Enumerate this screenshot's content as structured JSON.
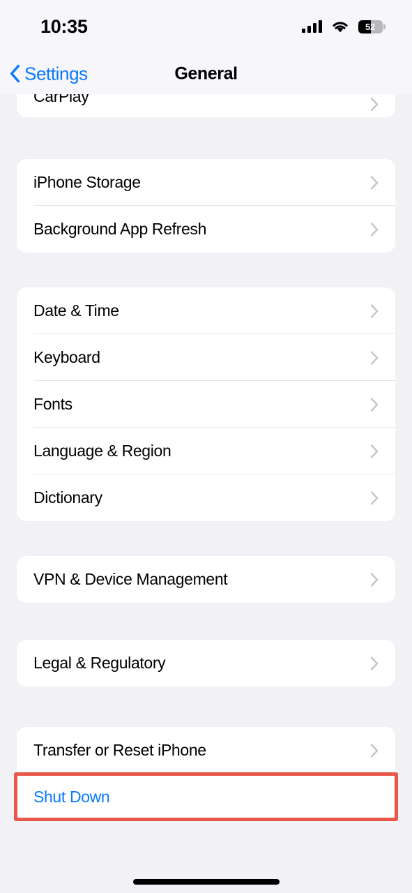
{
  "status_bar": {
    "time": "10:35",
    "signal_icon": "cellular-signal-icon",
    "signal_bars_filled": 4,
    "wifi_icon": "wifi-icon",
    "battery_icon": "battery-icon",
    "battery_percent": "52",
    "battery_fill_ratio": 0.52
  },
  "nav": {
    "back_icon": "chevron-left-icon",
    "back_label": "Settings",
    "title": "General"
  },
  "colors": {
    "accent_blue": "#0A7AFF",
    "background": "#F2F1F6",
    "card": "#FFFFFF",
    "separator": "#E6E5E9",
    "chevron": "#C5C5C7",
    "highlight_red": "#E8574A"
  },
  "sections": [
    {
      "id": "carplay-section",
      "clipped": true,
      "rows": [
        {
          "label": "CarPlay",
          "type": "disclosure"
        }
      ]
    },
    {
      "id": "storage-section",
      "clipped": false,
      "rows": [
        {
          "label": "iPhone Storage",
          "type": "disclosure"
        },
        {
          "label": "Background App Refresh",
          "type": "disclosure"
        }
      ]
    },
    {
      "id": "localization-section",
      "clipped": false,
      "rows": [
        {
          "label": "Date & Time",
          "type": "disclosure"
        },
        {
          "label": "Keyboard",
          "type": "disclosure"
        },
        {
          "label": "Fonts",
          "type": "disclosure"
        },
        {
          "label": "Language & Region",
          "type": "disclosure"
        },
        {
          "label": "Dictionary",
          "type": "disclosure"
        }
      ]
    },
    {
      "id": "vpn-section",
      "clipped": false,
      "rows": [
        {
          "label": "VPN & Device Management",
          "type": "disclosure"
        }
      ]
    },
    {
      "id": "legal-section",
      "clipped": false,
      "rows": [
        {
          "label": "Legal & Regulatory",
          "type": "disclosure"
        }
      ]
    },
    {
      "id": "reset-section",
      "clipped": false,
      "rows": [
        {
          "label": "Transfer or Reset iPhone",
          "type": "disclosure"
        },
        {
          "label": "Shut Down",
          "type": "action",
          "highlighted": true
        }
      ]
    }
  ],
  "home_indicator": "home-indicator"
}
